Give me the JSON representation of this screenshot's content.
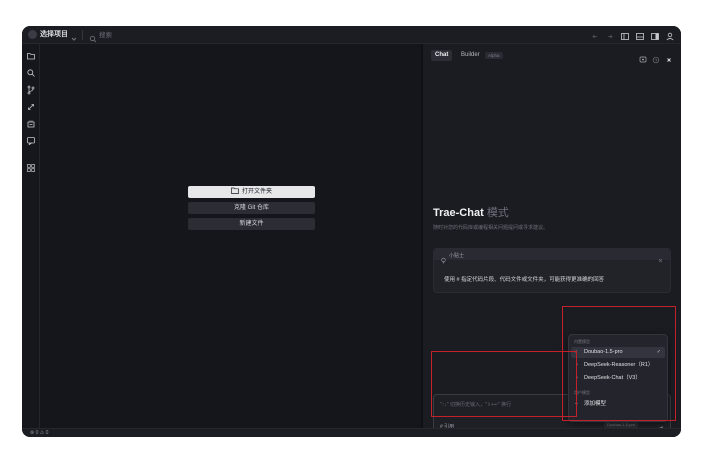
{
  "titlebar": {
    "project_name": "选择项目",
    "search_placeholder": "搜索"
  },
  "editor": {
    "open_folder": "打开文件夹",
    "clone_repo": "克隆 Git 仓库",
    "new_file": "新建文件"
  },
  "chat": {
    "tabs": [
      "Chat",
      "Builder"
    ],
    "alpha_badge": "Alpha",
    "mode_title": "Trae-Chat",
    "mode_title_cn": "模式",
    "mode_desc": "随时对您的代码库或编程相关问题提问或寻求建议。",
    "tip_label": "小贴士",
    "tip_text": "使用 # 指定代码片段、代码文件或文件夹，可能获得更准确的回答",
    "input_placeholder": "\"↑↓\" 切换历史输入，\"⇧+↵\" 换行",
    "input_ref": "# 引用",
    "model_chip": "Doubao-1.5-pro"
  },
  "dropdown": {
    "section_builtin": "内置模型",
    "section_custom": "用户模型",
    "models": [
      {
        "name": "Doubao-1.5-pro",
        "icon": "doubao-icon",
        "selected": true
      },
      {
        "name": "DeepSeek-Reasoner（R1）",
        "icon": "deepseek-icon",
        "selected": false
      },
      {
        "name": "DeepSeek-Chat（V3）",
        "icon": "deepseek-icon",
        "selected": false
      }
    ],
    "add_model": "添加模型"
  },
  "statusbar": {
    "text": "⊗ 0 ⚠ 0"
  },
  "colors": {
    "highlight": "#c0212b",
    "background": "#15161b",
    "panel": "#1b1c22"
  }
}
